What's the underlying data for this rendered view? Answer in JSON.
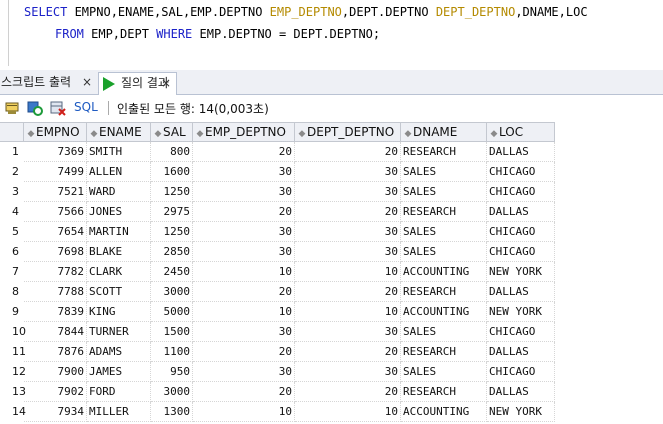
{
  "editor": {
    "line1": [
      {
        "text": "SELECT ",
        "cls": "kw"
      },
      {
        "text": "EMPNO,ENAME,SAL,EMP.DEPTNO ",
        "cls": ""
      },
      {
        "text": "EMP_DEPTNO",
        "cls": "al"
      },
      {
        "text": ",DEPT.DEPTNO ",
        "cls": ""
      },
      {
        "text": "DEPT_DEPTNO",
        "cls": "al"
      },
      {
        "text": ",DNAME,LOC",
        "cls": ""
      }
    ],
    "line2": [
      {
        "text": "FROM ",
        "cls": "kw"
      },
      {
        "text": "EMP,DEPT ",
        "cls": ""
      },
      {
        "text": "WHERE ",
        "cls": "kw"
      },
      {
        "text": "EMP.DEPTNO = DEPT.DEPTNO;",
        "cls": ""
      }
    ]
  },
  "tabs": {
    "script_output": "스크립트 출력",
    "query_result": "질의 결과",
    "close_glyph": "×"
  },
  "toolbar": {
    "sql_label": "SQL",
    "fetch_status": "인출된 모든 행: 14(0,003초)",
    "icons": [
      "pin-icon",
      "refresh-icon",
      "export-icon"
    ]
  },
  "grid": {
    "columns": [
      {
        "name": "EMPNO",
        "align": "num"
      },
      {
        "name": "ENAME",
        "align": "txt"
      },
      {
        "name": "SAL",
        "align": "num"
      },
      {
        "name": "EMP_DEPTNO",
        "align": "num"
      },
      {
        "name": "DEPT_DEPTNO",
        "align": "num"
      },
      {
        "name": "DNAME",
        "align": "txt"
      },
      {
        "name": "LOC",
        "align": "txt"
      }
    ],
    "sort_glyph": "◆",
    "rows": [
      [
        "1",
        "7369",
        "SMITH",
        "800",
        "20",
        "20",
        "RESEARCH",
        "DALLAS"
      ],
      [
        "2",
        "7499",
        "ALLEN",
        "1600",
        "30",
        "30",
        "SALES",
        "CHICAGO"
      ],
      [
        "3",
        "7521",
        "WARD",
        "1250",
        "30",
        "30",
        "SALES",
        "CHICAGO"
      ],
      [
        "4",
        "7566",
        "JONES",
        "2975",
        "20",
        "20",
        "RESEARCH",
        "DALLAS"
      ],
      [
        "5",
        "7654",
        "MARTIN",
        "1250",
        "30",
        "30",
        "SALES",
        "CHICAGO"
      ],
      [
        "6",
        "7698",
        "BLAKE",
        "2850",
        "30",
        "30",
        "SALES",
        "CHICAGO"
      ],
      [
        "7",
        "7782",
        "CLARK",
        "2450",
        "10",
        "10",
        "ACCOUNTING",
        "NEW YORK"
      ],
      [
        "8",
        "7788",
        "SCOTT",
        "3000",
        "20",
        "20",
        "RESEARCH",
        "DALLAS"
      ],
      [
        "9",
        "7839",
        "KING",
        "5000",
        "10",
        "10",
        "ACCOUNTING",
        "NEW YORK"
      ],
      [
        "10",
        "7844",
        "TURNER",
        "1500",
        "30",
        "30",
        "SALES",
        "CHICAGO"
      ],
      [
        "11",
        "7876",
        "ADAMS",
        "1100",
        "20",
        "20",
        "RESEARCH",
        "DALLAS"
      ],
      [
        "12",
        "7900",
        "JAMES",
        "950",
        "30",
        "30",
        "SALES",
        "CHICAGO"
      ],
      [
        "13",
        "7902",
        "FORD",
        "3000",
        "20",
        "20",
        "RESEARCH",
        "DALLAS"
      ],
      [
        "14",
        "7934",
        "MILLER",
        "1300",
        "10",
        "10",
        "ACCOUNTING",
        "NEW YORK"
      ]
    ]
  }
}
